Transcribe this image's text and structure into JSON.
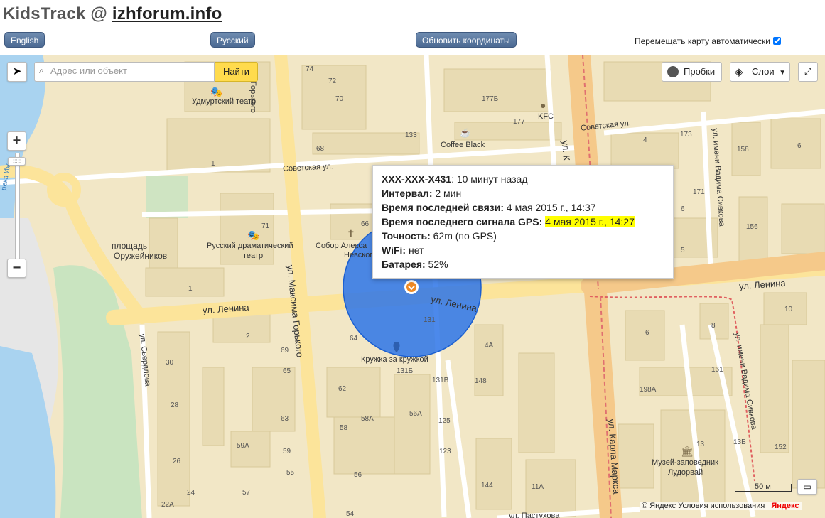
{
  "header": {
    "title_prefix": "KidsTrack @ ",
    "title_link": "izhforum.info",
    "btn_english": "English",
    "btn_russian": "Русский",
    "btn_refresh": "Обновить координаты",
    "auto_move_label": "Перемещать карту автоматически",
    "auto_move_checked": true
  },
  "map_controls": {
    "search_placeholder": "Адрес или объект",
    "find_label": "Найти",
    "traffic_label": "Пробки",
    "layers_label": "Слои",
    "zoom_in": "+",
    "zoom_out": "−",
    "scale_label": "50 м"
  },
  "popup": {
    "device_id": "XXX-XXX-X431",
    "device_ago": ": 10 минут назад",
    "interval_label": "Интервал:",
    "interval_value": " 2 мин",
    "last_contact_label": "Время последней связи:",
    "last_contact_value": " 4 мая 2015 г., 14:37",
    "last_gps_label": "Время последнего сигнала GPS:",
    "last_gps_value": "4 мая 2015 г., 14:27",
    "accuracy_label": "Точность:",
    "accuracy_value": " 62m (по GPS)",
    "wifi_label": "WiFi:",
    "wifi_value": " нет",
    "battery_label": "Батарея:",
    "battery_value": " 52%"
  },
  "map_labels": {
    "udm_theatre": "Удмуртский театр",
    "kfc": "KFC",
    "coffee_black": "Coffee Black",
    "sovetskaya_1": "Советская ул.",
    "sovetskaya_2": "Советская ул.",
    "gorkogo_top": "ул. Горького",
    "rus_theatre_1": "Русский драматический",
    "rus_theatre_2": "театр",
    "ploshchad_1": "площадь",
    "ploshchad_2": "Оружейников",
    "sobor": "Собор Алекса",
    "nevsky": "Невского",
    "lenina_left": "ул. Ленина",
    "lenina_mid": "ул. Ленина",
    "lenina_right": "ул. Ленина",
    "max_gorkogo": "ул. Максима Горького",
    "sverdlova": "ул. Свердлова",
    "reka_izh": "река Иж",
    "kruzhka": "Кружка за кружкой",
    "karla_marksa_top": "ул. К",
    "karla_marksa": "ул. Карла Маркса",
    "sivkova_top": "ул. имени Вадима Сивкова",
    "sivkova_bottom": "ул. имени Вадима Сивкова",
    "museum_1": "Музей-заповедник",
    "museum_2": "Лудорвай",
    "pastukhova": "ул. Пастухова",
    "yandex_copy": "© Яндекс",
    "terms": "Условия использования",
    "yandex_logo": "Яндекс"
  },
  "house_numbers": [
    "74",
    "72",
    "70",
    "1",
    "68",
    "133",
    "177Б",
    "177",
    "4",
    "173",
    "158",
    "6",
    "171",
    "156",
    "5",
    "71",
    "1",
    "66",
    "2",
    "69",
    "65",
    "64",
    "131",
    "4A",
    "148",
    "30",
    "28",
    "62",
    "58A",
    "56A",
    "125",
    "123",
    "63",
    "59A",
    "59",
    "58",
    "56",
    "26",
    "55",
    "57",
    "24",
    "22A",
    "54",
    "144",
    "11A",
    "6",
    "8",
    "10",
    "161",
    "198A",
    "13",
    "13Б",
    "152",
    "131Б",
    "131В",
    "6"
  ],
  "colors": {
    "accent_button": "#5474a0",
    "accuracy_circle": "#1e6fe0",
    "main_road": "#f5c98a",
    "yellow_road": "#fce49a"
  }
}
